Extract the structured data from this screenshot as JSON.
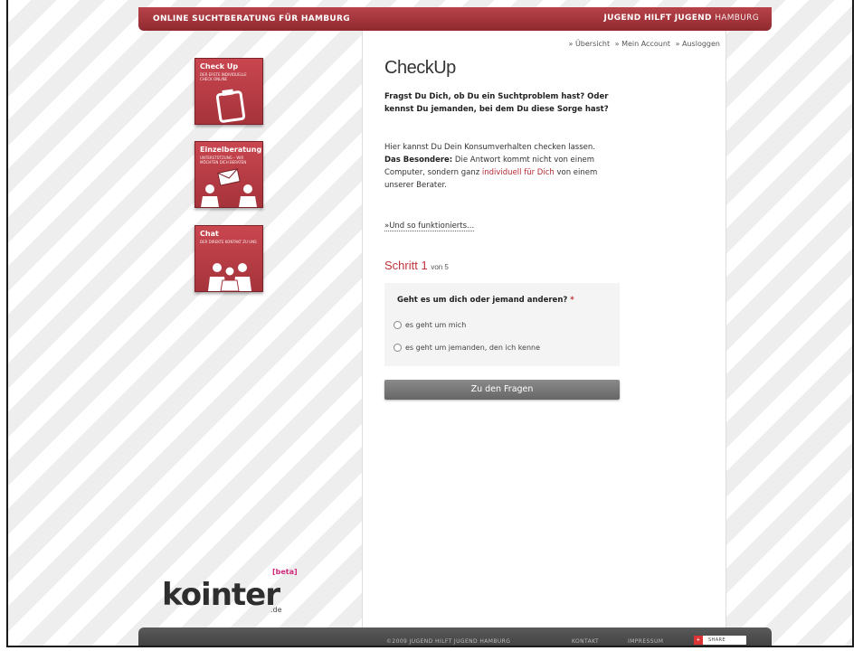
{
  "header": {
    "left_title": "ONLINE SUCHTBERATUNG FÜR HAMBURG",
    "right_title_bold": "JUGEND HILFT JUGEND",
    "right_title_thin": "HAMBURG",
    "accent_color": "#a6333b"
  },
  "topnav": {
    "items": [
      "» Übersicht",
      "» Mein Account",
      "» Ausloggen"
    ]
  },
  "sidebar": {
    "tiles": [
      {
        "title": "Check Up",
        "subtitle": "DER ERSTE INDIVIDUELLE CHECK ONLINE",
        "icon": "clipboard-icon"
      },
      {
        "title": "Einzelberatung",
        "subtitle": "UNTERSTÜTZUNG – WIR MÖCHTEN DICH BERATEN",
        "icon": "mail-people-icon"
      },
      {
        "title": "Chat",
        "subtitle": "DER DIREKTE KONTAKT ZU UNS",
        "icon": "group-people-icon"
      }
    ]
  },
  "main": {
    "title": "CheckUp",
    "intro_question": "Fragst Du Dich, ob Du ein Suchtproblem hast? Oder kennst Du jemanden, bei dem Du diese Sorge hast?",
    "intro_p1": "Hier kannst Du Dein Konsumverhalten checken lassen.",
    "intro_bold": "Das Besondere:",
    "intro_p2a": "Die Antwort kommt nicht von einem Computer, sondern ganz",
    "intro_highlight": "individuell für Dich",
    "intro_p2b": "von einem unserer Berater.",
    "howto_link": "»Und so funktionierts...",
    "step_label": "Schritt 1",
    "step_of": "von 5",
    "question": "Geht es um dich oder jemand anderen?",
    "required_mark": "*",
    "options": [
      "es geht um mich",
      "es geht um jemanden, den ich kenne"
    ],
    "submit_label": "Zu den Fragen"
  },
  "logo": {
    "word": "kointer",
    "beta": "[beta]",
    "tld": ".de"
  },
  "footer": {
    "copyright": "©2009 JUGEND HILFT JUGEND HAMBURG",
    "kontakt": "KONTAKT",
    "impressum": "IMPRESSUM",
    "share": "SHARE"
  }
}
